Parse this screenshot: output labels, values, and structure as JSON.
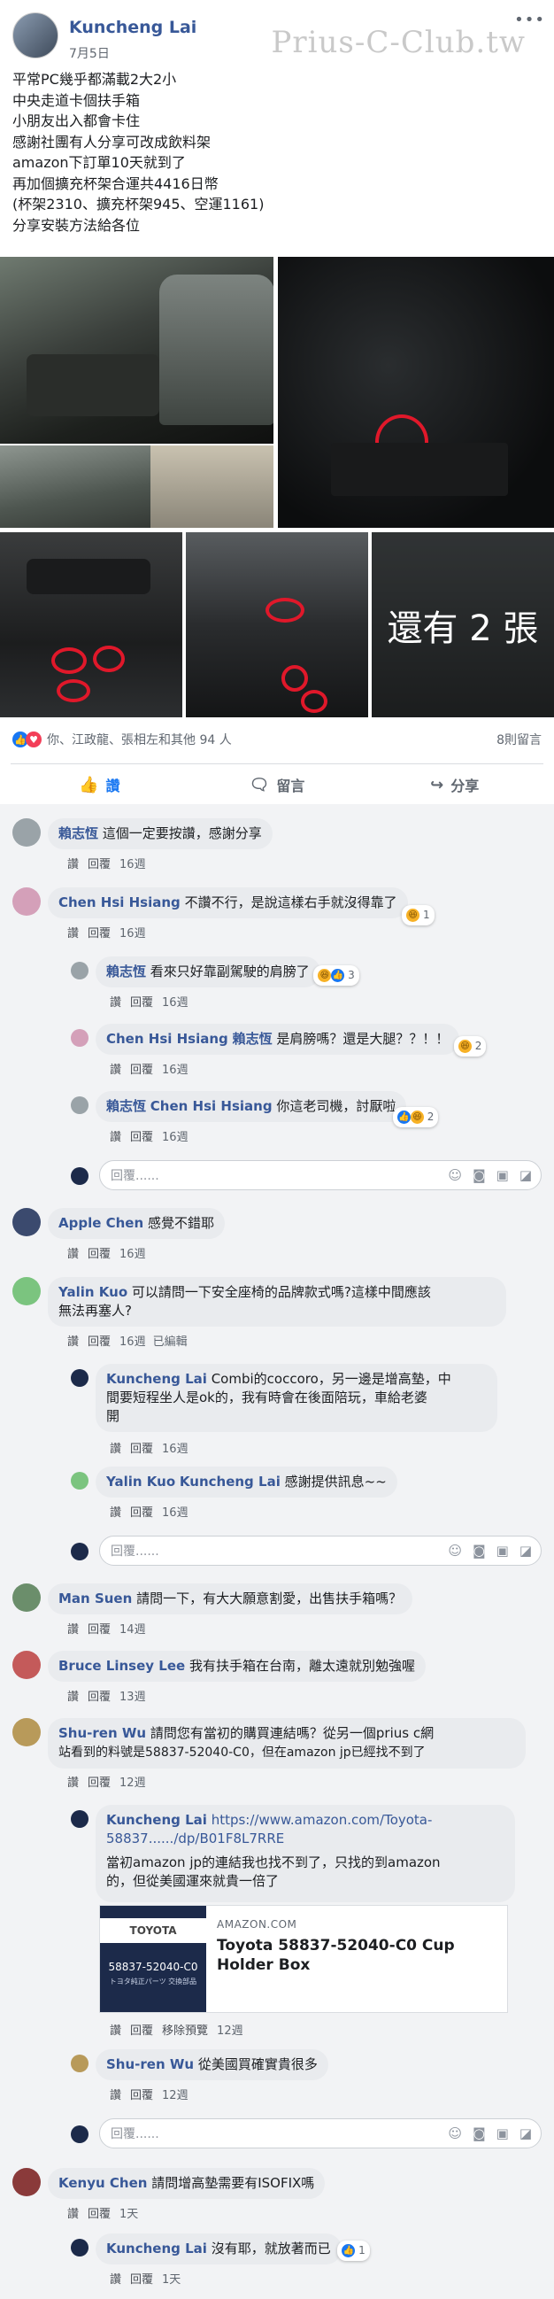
{
  "post": {
    "author": "Kuncheng Lai",
    "date": "7月5日",
    "watermark": "Prius-C-Club.tw",
    "lines": [
      "平常PC幾乎都滿載2大2小",
      "中央走道卡個扶手箱",
      "小朋友出入都會卡住",
      "感謝社團有人分享可改成飲料架",
      "amazon下訂單10天就到了",
      "再加個擴充杯架合運共4416日幣",
      "(杯架2310、擴充杯架945、空運1161)",
      "分享安裝方法給各位"
    ],
    "photo_overlay": "還有 2 張"
  },
  "reactions": {
    "names": "你、江政龍、張相左和其他 94 人",
    "comment_count": "8則留言"
  },
  "actions": {
    "like": "讚",
    "comment": "留言",
    "share": "分享"
  },
  "meta_labels": {
    "like": "讚",
    "reply": "回覆",
    "edited": "已編輯",
    "remove_preview": "移除預覽"
  },
  "reply_placeholder": "回覆......",
  "comments": [
    {
      "name": "賴志恆",
      "text": "這個一定要按讚，感謝分享",
      "time": "16週"
    },
    {
      "name": "Chen Hsi Hsiang",
      "text": "不讚不行，是說這樣右手就沒得靠了",
      "time": "16週",
      "react": "1"
    },
    {
      "name": "賴志恆",
      "text": "看來只好靠副駕駛的肩膀了",
      "time": "16週",
      "react": "3"
    },
    {
      "name": "Chen Hsi Hsiang",
      "mention": "賴志恆",
      "text": "是肩膀嗎？還是大腿？？！！",
      "time": "16週",
      "react": "2"
    },
    {
      "name": "賴志恆",
      "mention": "Chen Hsi Hsiang",
      "text": "你這老司機，討厭啦",
      "time": "16週",
      "react": "2"
    },
    {
      "name": "Apple Chen",
      "text": "感覺不錯耶",
      "time": "16週"
    },
    {
      "name": "Yalin Kuo",
      "text1": "可以請問一下安全座椅的品牌款式嗎?這樣中間應該",
      "text2": "無法再塞人?",
      "time": "16週"
    },
    {
      "name": "Kuncheng Lai",
      "text1": "Combi的coccoro，另一邊是增高墊，中",
      "text2": "間要短程坐人是ok的，我有時會在後面陪玩，車給老婆",
      "text3": "開",
      "time": "16週"
    },
    {
      "name": "Yalin Kuo",
      "mention": "Kuncheng Lai",
      "text": "感謝提供訊息~~",
      "time": "16週"
    },
    {
      "name": "Man Suen",
      "text": "請問一下，有大大願意割愛，出售扶手箱嗎？",
      "time": "14週"
    },
    {
      "name": "Bruce Linsey Lee",
      "text": "我有扶手箱在台南，離太遠就別勉強喔",
      "time": "13週"
    },
    {
      "name": "Shu-ren Wu",
      "text1": "請問您有當初的購買連結嗎？從另一個prius c網",
      "text2": "站看到的料號是58837-52040-C0，但在amazon jp已經找不到了",
      "time": "12週"
    },
    {
      "name": "Kuncheng Lai",
      "link1": "https://www.amazon.com/Toyota-",
      "link2": "58837....../dp/B01F8L7RRE",
      "text1": "當初amazon jp的連結我也找不到了，只找的到amazon",
      "text2": "的，但從美國運來就貴一倍了",
      "time": "12週"
    },
    {
      "name": "Shu-ren Wu",
      "text": "從美國買確實貴很多",
      "time": "12週"
    },
    {
      "name": "Kenyu Chen",
      "text": "請問增高墊需要有ISOFIX嗎",
      "time": "1天"
    },
    {
      "name": "Kuncheng Lai",
      "text": "沒有耶，就放著而已",
      "time": "1天",
      "react": "1"
    }
  ],
  "link_preview": {
    "thumb_brand": "TOYOTA",
    "thumb_part": "58837-52040-C0",
    "thumb_sub": "トヨタ純正パーツ 交換部品",
    "domain": "AMAZON.COM",
    "title": "Toyota 58837-52040-C0 Cup Holder Box"
  }
}
